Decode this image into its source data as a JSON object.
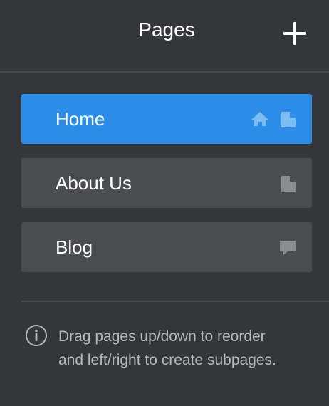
{
  "header": {
    "title": "Pages",
    "add_icon": "plus-icon"
  },
  "pages": [
    {
      "label": "Home",
      "active": true,
      "icons": [
        "home-icon",
        "document-icon"
      ]
    },
    {
      "label": "About Us",
      "active": false,
      "icons": [
        "document-icon"
      ]
    },
    {
      "label": "Blog",
      "active": false,
      "icons": [
        "comment-icon"
      ]
    }
  ],
  "hint": {
    "icon": "info-icon",
    "line1": "Drag pages up/down to reorder",
    "line2": "and left/right to create subpages."
  },
  "colors": {
    "background": "#33373b",
    "active": "#2b8de8",
    "item": "#494d52"
  }
}
